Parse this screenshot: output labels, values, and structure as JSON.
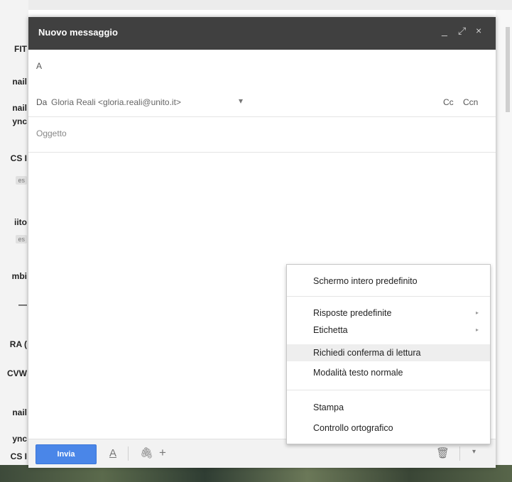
{
  "background": {
    "inbox_rows": [
      "FIT",
      "nail",
      "nail",
      "ync",
      "CS I",
      "es",
      "iito",
      "es",
      "mbi",
      "—",
      "RA (",
      "CVW",
      "nail",
      "ync",
      "CS I"
    ]
  },
  "compose": {
    "title": "Nuovo messaggio",
    "controls": {
      "minimize": "_",
      "expand": "⤢",
      "close": "×"
    },
    "to_label": "A",
    "from_label": "Da",
    "from_value": "Gloria Reali <gloria.reali@unito.it>",
    "from_caret": "▾",
    "cc_label": "Cc",
    "bcc_label": "Ccn",
    "subject_placeholder": "Oggetto"
  },
  "toolbar": {
    "send_label": "Invia",
    "format_icon": "A",
    "attach_icon": "🖇",
    "more_icon": "+",
    "trash_icon": "🗑",
    "options_icon": "▾"
  },
  "menu": {
    "items": [
      {
        "label": "Schermo intero predefinito"
      },
      {
        "label": "Risposte predefinite",
        "arrow": "▸"
      },
      {
        "label": "Etichetta",
        "arrow": "▸"
      },
      {
        "label": "Richiedi conferma di lettura"
      },
      {
        "label": "Modalità testo normale"
      },
      {
        "label": "Stampa"
      },
      {
        "label": "Controllo ortografico"
      }
    ]
  },
  "colors": {
    "titlebar": "#404040",
    "send_button": "#4a86e8",
    "menu_highlight": "#eeeeee"
  }
}
